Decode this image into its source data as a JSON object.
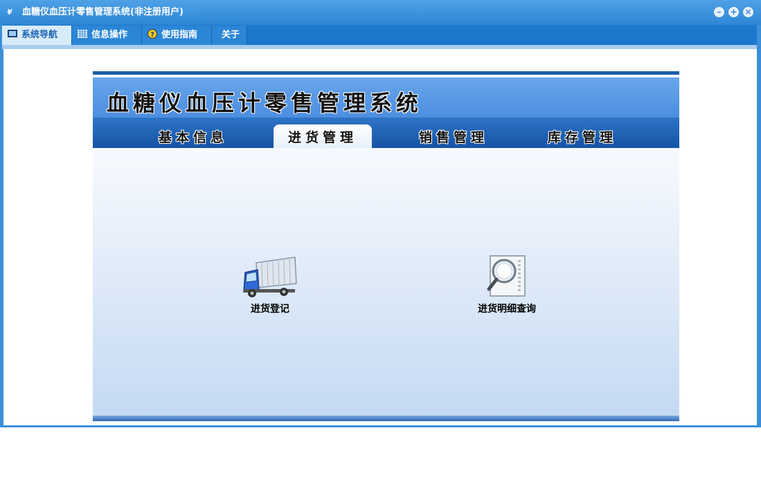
{
  "window": {
    "title": "血糖仪血压计零售管理系统(非注册用户)",
    "controls": [
      "minimize-icon",
      "maximize-icon",
      "close-icon"
    ]
  },
  "menu": [
    {
      "label": "系统导航",
      "icon": "monitor-icon",
      "active": true
    },
    {
      "label": "信息操作",
      "icon": "grid-icon",
      "active": false
    },
    {
      "label": "使用指南",
      "icon": "help-icon",
      "active": false
    },
    {
      "label": "关于",
      "icon": "",
      "active": false
    }
  ],
  "banner": {
    "title": "血糖仪血压计零售管理系统"
  },
  "tabs": [
    {
      "label": "基本信息",
      "active": false
    },
    {
      "label": "进货管理",
      "active": true
    },
    {
      "label": "销售管理",
      "active": false
    },
    {
      "label": "库存管理",
      "active": false
    }
  ],
  "actions": [
    {
      "label": "进货登记",
      "icon": "truck-icon"
    },
    {
      "label": "进货明细查询",
      "icon": "magnifier-document-icon"
    }
  ],
  "colors": {
    "title_bar": "#3b8fd6",
    "menu_bar": "#1c78cc",
    "tab_bar": "#1553a4"
  }
}
